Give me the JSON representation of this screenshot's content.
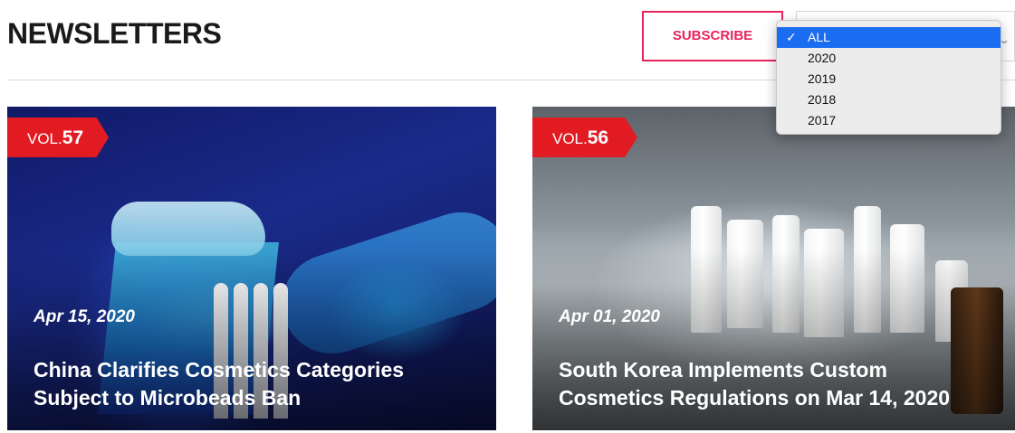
{
  "header": {
    "title": "NEWSLETTERS",
    "subscribe_label": "SUBSCRIBE"
  },
  "year_filter": {
    "selected": "ALL",
    "options": [
      "ALL",
      "2020",
      "2019",
      "2018",
      "2017"
    ]
  },
  "cards": [
    {
      "vol_prefix": "VOL.",
      "vol_number": "57",
      "date": "Apr 15, 2020",
      "title": "China Clarifies Cosmetics Categories Subject to Microbeads Ban"
    },
    {
      "vol_prefix": "VOL.",
      "vol_number": "56",
      "date": "Apr 01, 2020",
      "title": "South Korea Implements Custom Cosmetics Regulations on Mar 14, 2020"
    }
  ],
  "colors": {
    "accent": "#e8245e",
    "badge": "#e21b23",
    "dropdown_highlight": "#1a6df0"
  }
}
